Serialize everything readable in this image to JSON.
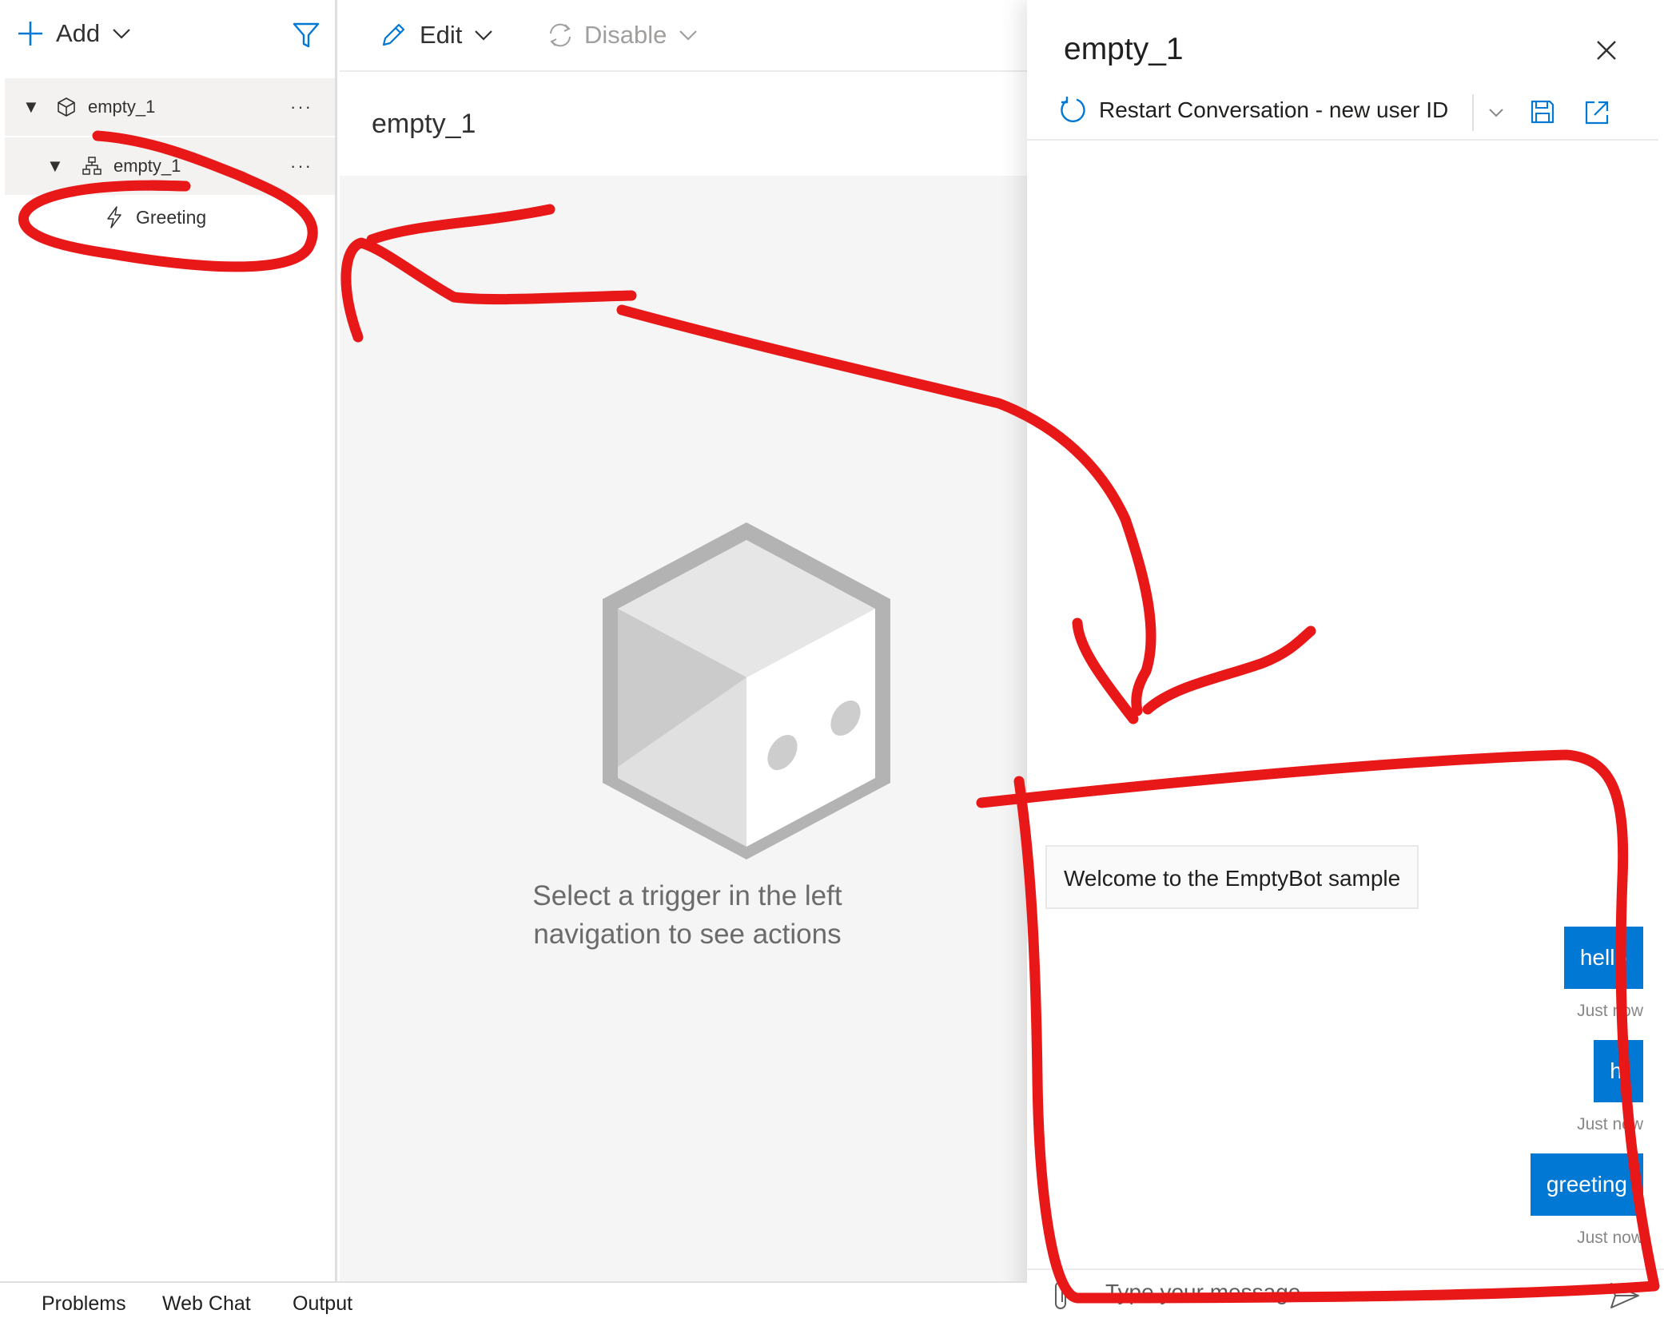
{
  "nav": {
    "add_label": "Add",
    "root_item": "empty_1",
    "dialog_item": "empty_1",
    "trigger_item": "Greeting",
    "more_glyph": "···"
  },
  "editor": {
    "edit_label": "Edit",
    "disable_label": "Disable",
    "title": "empty_1",
    "placeholder": "Select a trigger in the left navigation to see actions"
  },
  "chat": {
    "title": "empty_1",
    "restart_label": "Restart Conversation - new user ID",
    "bot_message": "Welcome to the EmptyBot sample",
    "messages": [
      {
        "text": "hello",
        "time": "Just now"
      },
      {
        "text": "hi",
        "time": "Just now"
      },
      {
        "text": "greeting",
        "time": "Just now"
      }
    ],
    "input_placeholder": "Type your message"
  },
  "bottom_tabs": [
    "Problems",
    "Web Chat",
    "Output"
  ],
  "colors": {
    "accent": "#0078d4",
    "annotation": "#e81818",
    "selected_row": "#f3f2f1",
    "canvas": "#f5f5f5"
  }
}
